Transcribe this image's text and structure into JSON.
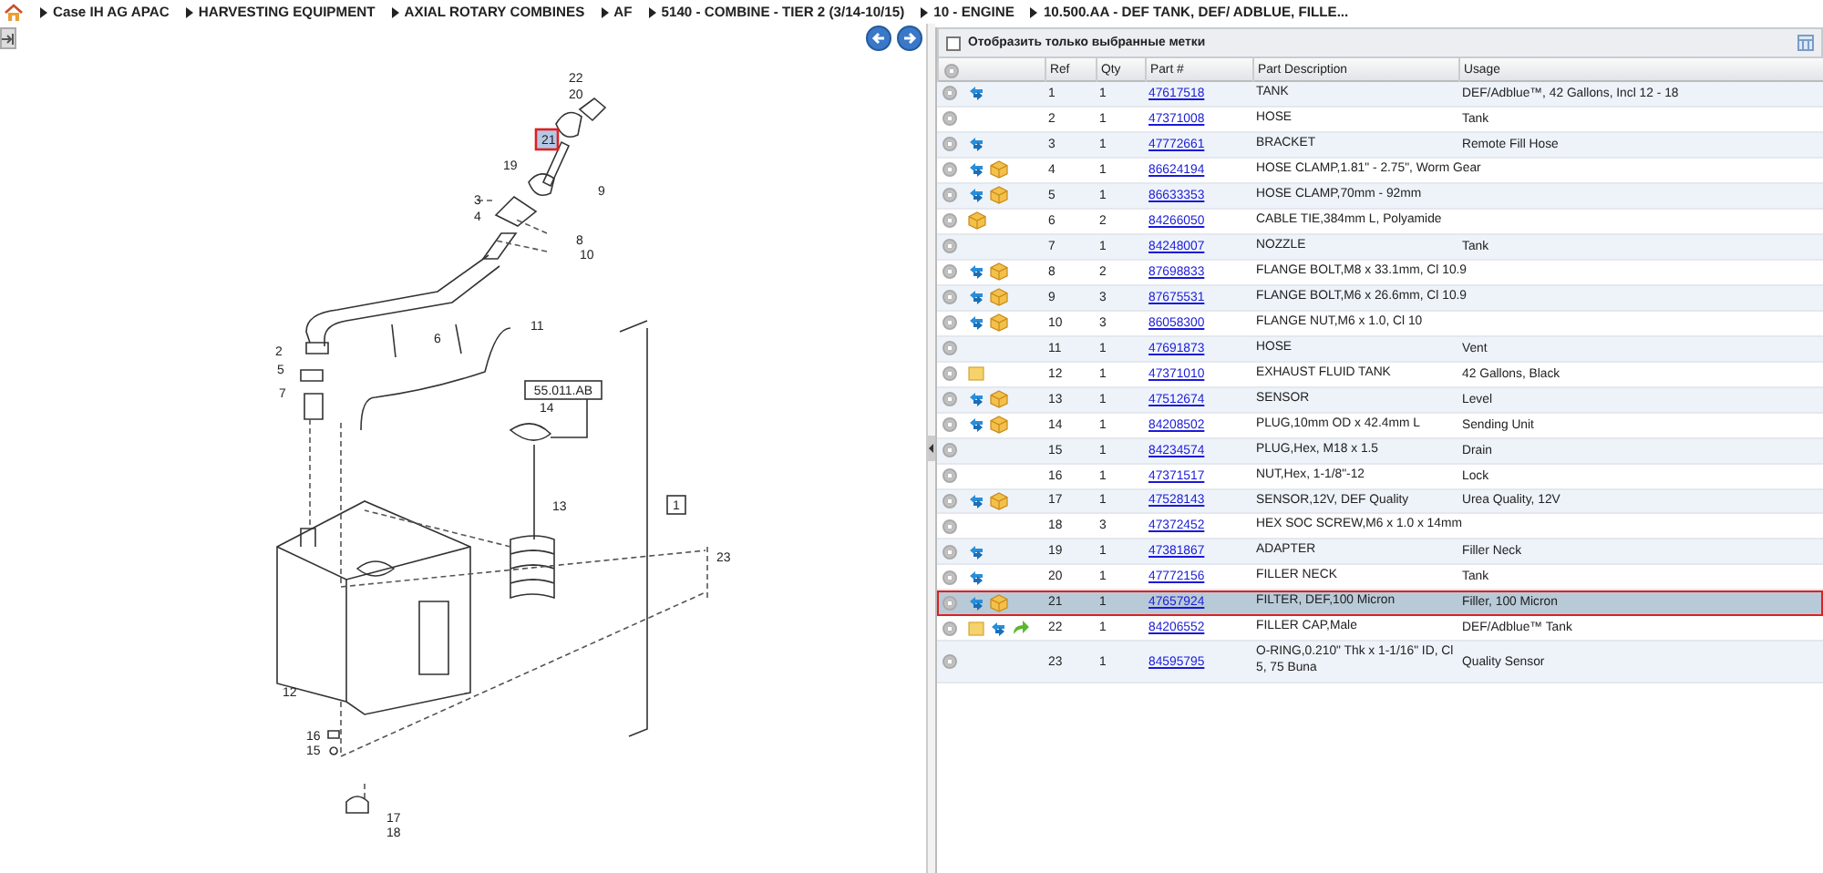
{
  "breadcrumb": [
    {
      "label": "Case IH AG APAC"
    },
    {
      "label": "HARVESTING EQUIPMENT"
    },
    {
      "label": "AXIAL ROTARY COMBINES"
    },
    {
      "label": "AF"
    },
    {
      "label": "5140 - COMBINE - TIER 2 (3/14-10/15)"
    },
    {
      "label": "10 - ENGINE"
    },
    {
      "label": "10.500.AA - DEF TANK, DEF/ ADBLUE, FILLE..."
    }
  ],
  "diagram": {
    "callouts": [
      {
        "label": "22",
        "selected": false
      },
      {
        "label": "20",
        "selected": false
      },
      {
        "label": "21",
        "selected": true
      },
      {
        "label": "19",
        "selected": false
      },
      {
        "label": "9",
        "selected": false
      },
      {
        "label": "3",
        "selected": false
      },
      {
        "label": "4",
        "selected": false
      },
      {
        "label": "8",
        "selected": false
      },
      {
        "label": "10",
        "selected": false
      },
      {
        "label": "11",
        "selected": false
      },
      {
        "label": "6",
        "selected": false
      },
      {
        "label": "2",
        "selected": false
      },
      {
        "label": "5",
        "selected": false
      },
      {
        "label": "7",
        "selected": false
      },
      {
        "label": "14",
        "selected": false
      },
      {
        "label": "13",
        "selected": false
      },
      {
        "label": "23",
        "selected": false
      },
      {
        "label": "12",
        "selected": false
      },
      {
        "label": "16",
        "selected": false
      },
      {
        "label": "15",
        "selected": false
      },
      {
        "label": "17",
        "selected": false
      },
      {
        "label": "18",
        "selected": false
      }
    ],
    "reference_tags": [
      "55.011.AB",
      "1"
    ]
  },
  "parts_panel": {
    "filter": {
      "label": "Отобразить только выбранные метки",
      "checked": false
    },
    "columns": [
      "Ref",
      "Qty",
      "Part #",
      "Part Description",
      "Usage"
    ],
    "rows": [
      {
        "note": false,
        "swap": true,
        "package": false,
        "redo": false,
        "ref": "1",
        "qty": "1",
        "part": "47617518",
        "description": "TANK",
        "usage": "DEF/Adblue™, 42 Gallons, Incl 12 - 18",
        "selected": false
      },
      {
        "note": false,
        "swap": false,
        "package": false,
        "redo": false,
        "ref": "2",
        "qty": "1",
        "part": "47371008",
        "description": "HOSE",
        "usage": "Tank",
        "selected": false
      },
      {
        "note": false,
        "swap": true,
        "package": false,
        "redo": false,
        "ref": "3",
        "qty": "1",
        "part": "47772661",
        "description": "BRACKET",
        "usage": "Remote Fill Hose",
        "selected": false
      },
      {
        "note": false,
        "swap": true,
        "package": true,
        "redo": false,
        "ref": "4",
        "qty": "1",
        "part": "86624194",
        "description": "HOSE CLAMP,1.81\" - 2.75\", Worm Gear",
        "selected": false
      },
      {
        "note": false,
        "swap": true,
        "package": true,
        "redo": false,
        "ref": "5",
        "qty": "1",
        "part": "86633353",
        "description": "HOSE CLAMP,70mm - 92mm",
        "selected": false
      },
      {
        "note": false,
        "swap": false,
        "package": true,
        "redo": false,
        "ref": "6",
        "qty": "2",
        "part": "84266050",
        "description": "CABLE TIE,384mm L, Polyamide",
        "selected": false
      },
      {
        "note": false,
        "swap": false,
        "package": false,
        "redo": false,
        "ref": "7",
        "qty": "1",
        "part": "84248007",
        "description": "NOZZLE",
        "usage": "Tank",
        "selected": false
      },
      {
        "note": false,
        "swap": true,
        "package": true,
        "redo": false,
        "ref": "8",
        "qty": "2",
        "part": "87698833",
        "description": "FLANGE BOLT,M8 x 33.1mm, Cl 10.9",
        "selected": false
      },
      {
        "note": false,
        "swap": true,
        "package": true,
        "redo": false,
        "ref": "9",
        "qty": "3",
        "part": "87675531",
        "description": "FLANGE BOLT,M6 x 26.6mm, Cl 10.9",
        "selected": false
      },
      {
        "note": false,
        "swap": true,
        "package": true,
        "redo": false,
        "ref": "10",
        "qty": "3",
        "part": "86058300",
        "description": "FLANGE NUT,M6 x 1.0, Cl 10",
        "selected": false
      },
      {
        "note": false,
        "swap": false,
        "package": false,
        "redo": false,
        "ref": "11",
        "qty": "1",
        "part": "47691873",
        "description": "HOSE",
        "usage": "Vent",
        "selected": false
      },
      {
        "note": true,
        "swap": false,
        "package": false,
        "redo": false,
        "ref": "12",
        "qty": "1",
        "part": "47371010",
        "description": "EXHAUST FLUID TANK",
        "usage": "42 Gallons, Black",
        "selected": false
      },
      {
        "note": false,
        "swap": true,
        "package": true,
        "redo": false,
        "ref": "13",
        "qty": "1",
        "part": "47512674",
        "description": "SENSOR",
        "usage": "Level",
        "selected": false
      },
      {
        "note": false,
        "swap": true,
        "package": true,
        "redo": false,
        "ref": "14",
        "qty": "1",
        "part": "84208502",
        "description": "PLUG,10mm OD x 42.4mm L",
        "usage": "Sending Unit",
        "selected": false
      },
      {
        "note": false,
        "swap": false,
        "package": false,
        "redo": false,
        "ref": "15",
        "qty": "1",
        "part": "84234574",
        "description": "PLUG,Hex, M18 x 1.5",
        "usage": "Drain",
        "selected": false
      },
      {
        "note": false,
        "swap": false,
        "package": false,
        "redo": false,
        "ref": "16",
        "qty": "1",
        "part": "47371517",
        "description": "NUT,Hex, 1-1/8\"-12",
        "usage": "Lock",
        "selected": false
      },
      {
        "note": false,
        "swap": true,
        "package": true,
        "redo": false,
        "ref": "17",
        "qty": "1",
        "part": "47528143",
        "description": "SENSOR,12V, DEF Quality",
        "usage": "Urea Quality, 12V",
        "selected": false
      },
      {
        "note": false,
        "swap": false,
        "package": false,
        "redo": false,
        "ref": "18",
        "qty": "3",
        "part": "47372452",
        "description": "HEX SOC SCREW,M6 x 1.0 x 14mm",
        "selected": false
      },
      {
        "note": false,
        "swap": true,
        "package": false,
        "redo": false,
        "ref": "19",
        "qty": "1",
        "part": "47381867",
        "description": "ADAPTER",
        "usage": "Filler Neck",
        "selected": false
      },
      {
        "note": false,
        "swap": true,
        "package": false,
        "redo": false,
        "ref": "20",
        "qty": "1",
        "part": "47772156",
        "description": "FILLER NECK",
        "usage": "Tank",
        "selected": false
      },
      {
        "note": false,
        "swap": true,
        "package": true,
        "redo": false,
        "ref": "21",
        "qty": "1",
        "part": "47657924",
        "description": "FILTER, DEF,100 Micron",
        "usage": "Filler, 100 Micron",
        "selected": true
      },
      {
        "note": true,
        "swap": true,
        "package": false,
        "redo": true,
        "ref": "22",
        "qty": "1",
        "part": "84206552",
        "description": "FILLER CAP,Male",
        "usage": "DEF/Adblue™ Tank",
        "selected": false
      },
      {
        "note": false,
        "swap": false,
        "package": false,
        "redo": false,
        "ref": "23",
        "qty": "1",
        "part": "84595795",
        "description": "O-RING,0.210\" Thk x 1-1/16\" ID, Cl 5, 75 Buna",
        "usage": "Quality Sensor",
        "selected": false
      }
    ]
  }
}
